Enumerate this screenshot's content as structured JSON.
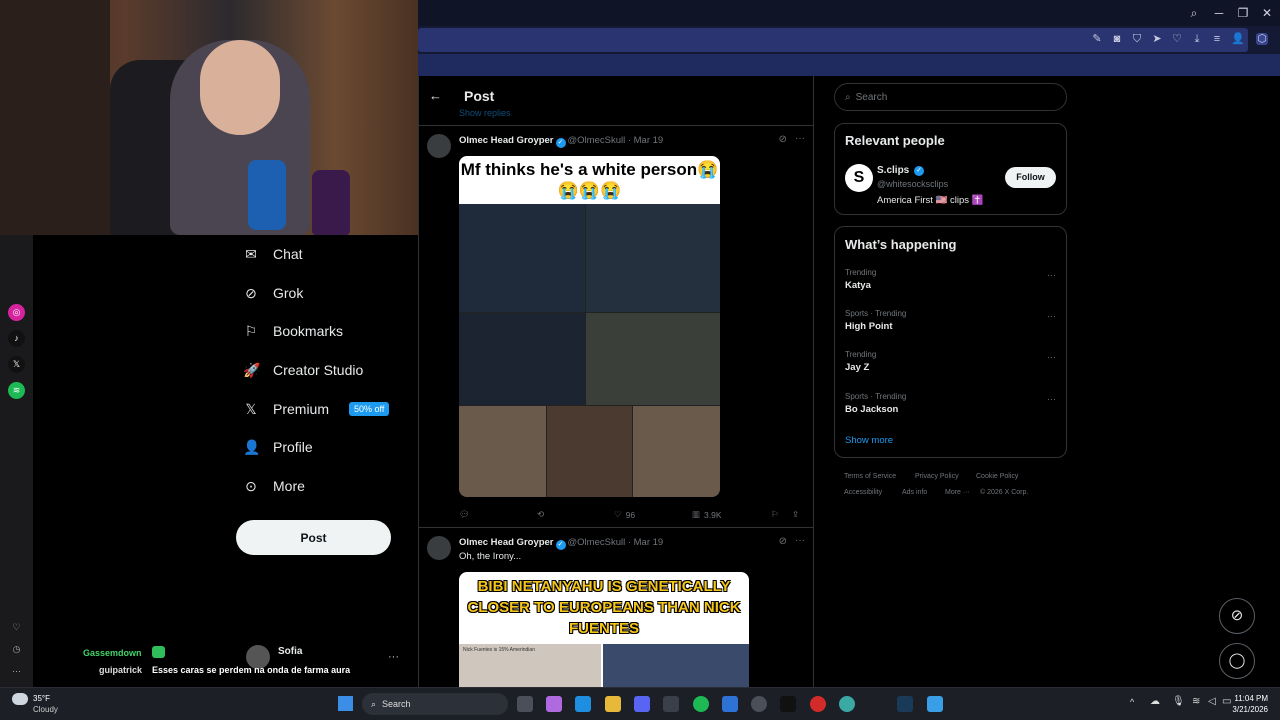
{
  "webcam": {
    "description_label": ""
  },
  "sidebar": {
    "items": [
      {
        "label": "Chat",
        "icon": "envelope-icon"
      },
      {
        "label": "Grok",
        "icon": "grok-icon"
      },
      {
        "label": "Bookmarks",
        "icon": "bookmark-icon"
      },
      {
        "label": "Creator Studio",
        "icon": "rocket-icon"
      },
      {
        "label": "Premium",
        "icon": "x-logo-icon"
      },
      {
        "label": "Profile",
        "icon": "person-icon"
      },
      {
        "label": "More",
        "icon": "more-circle-icon"
      }
    ],
    "premium_badge": "50% off",
    "post_button": "Post"
  },
  "chat": {
    "line1_user": "Gassemdown",
    "line2_user": "guipatrick",
    "line2_text": "Esses caras se perdem na onda de farma aura",
    "account_name": "Sofia"
  },
  "main": {
    "header_title": "Post",
    "show_replies": "Show replies",
    "tweets": [
      {
        "name": "Olmec Head Groyper",
        "handle": "@OlmecSkull",
        "date": "· Mar 19",
        "image_text": "Mf thinks he's a white person😭😭😭😭",
        "likes": "96",
        "views": "3.9K"
      },
      {
        "name": "Olmec Head Groyper",
        "handle": "@OlmecSkull",
        "date": "· Mar 19",
        "text": "Oh, the Irony...",
        "image_text": "BIBI NETANYAHU IS GENETICALLY CLOSER TO EUROPEANS THAN NICK FUENTES",
        "image_caption": "Nick Fuentes is 15% Amerindian"
      }
    ]
  },
  "right": {
    "search_placeholder": "Search",
    "relevant_title": "Relevant people",
    "person": {
      "name": "S.clips",
      "handle": "@whitesocksclips",
      "bio": "America First 🇺🇸 clips ✝️",
      "follow": "Follow"
    },
    "happening_title": "What’s happening",
    "trends": [
      {
        "category": "Trending",
        "name": "Katya"
      },
      {
        "category": "Sports · Trending",
        "name": "High Point"
      },
      {
        "category": "Trending",
        "name": "Jay Z"
      },
      {
        "category": "Sports · Trending",
        "name": "Bo Jackson"
      }
    ],
    "show_more": "Show more",
    "footer": [
      "Terms of Service",
      "Privacy Policy",
      "Cookie Policy",
      "Accessibility",
      "Ads info",
      "More ···",
      "© 2026 X Corp."
    ]
  },
  "taskbar": {
    "weather_temp": "35°F",
    "weather_desc": "Cloudy",
    "search": "Search",
    "time": "11:04 PM",
    "date": "3/21/2026"
  },
  "colors": {
    "accent": "#1d9bf0",
    "browser_chrome": "#141a33",
    "tab_strip": "#1f2a5e"
  }
}
